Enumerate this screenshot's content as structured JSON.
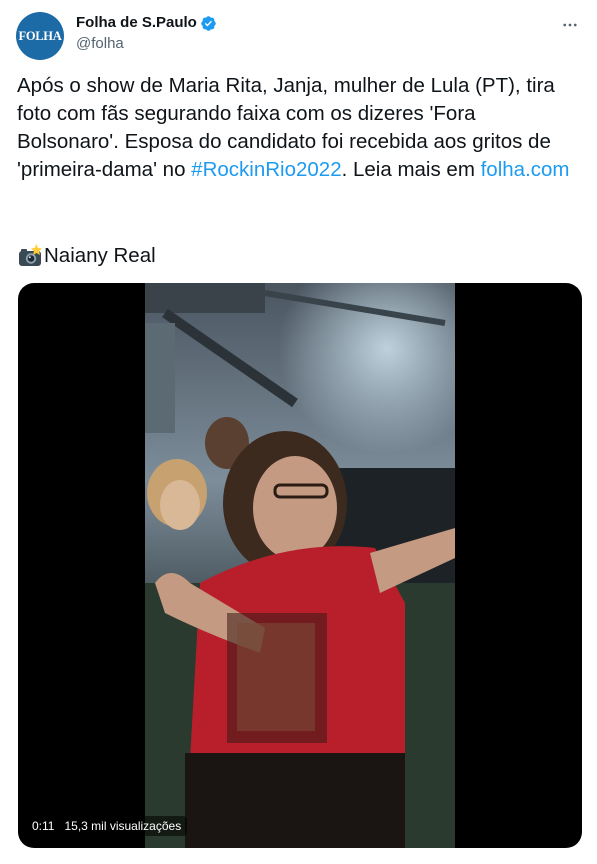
{
  "author": {
    "display_name": "Folha de S.Paulo",
    "handle": "@folha",
    "avatar_text": "FOLHA",
    "avatar_color": "#1c6aa6",
    "verified_icon": "verified-badge-icon"
  },
  "tweet": {
    "text_before_hashtag": "Após o show de Maria Rita, Janja, mulher de Lula (PT), tira foto com fãs segurando faixa com os dizeres 'Fora Bolsonaro'. Esposa do candidato foi recebida aos gritos de 'primeira-dama' no ",
    "hashtag": "#RockinRio2022",
    "text_after_hashtag": ". Leia mais em ",
    "link": "folha.com",
    "credit_icon": "camera-flash-icon",
    "credit": "Naiany Real"
  },
  "video": {
    "elapsed": "0:11",
    "views": "15,3 mil visualizações"
  },
  "colors": {
    "link": "#1d9bf0",
    "text": "#0f1419",
    "secondary": "#536471",
    "verified": "#1d9bf0"
  }
}
